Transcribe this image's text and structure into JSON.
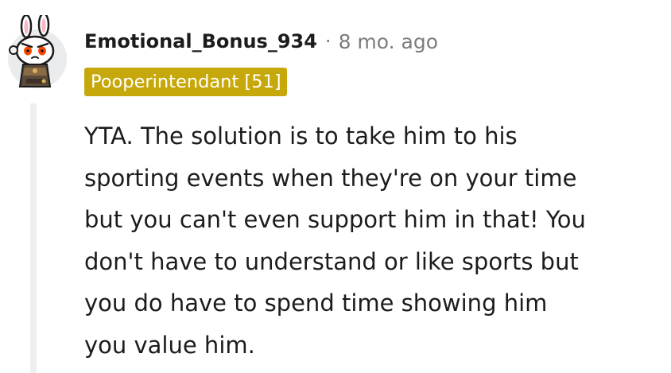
{
  "comment": {
    "author": "Emotional_Bonus_934",
    "separator": "·",
    "timestamp": "8 mo. ago",
    "flair": "Pooperintendant [51]",
    "lines": [
      "YTA. The solution is to take him to his",
      "sporting events when they're on your time",
      "but you can't even support him in that! You",
      "don't have to understand or like sports but",
      "you do have to spend time showing him",
      "you value him."
    ]
  },
  "colors": {
    "flair_background": "#c7a80a",
    "thread_line": "#edeff1",
    "meta_text": "#7c7c7c"
  },
  "icons": {
    "avatar": "snoo-avatar-bunny-ears"
  }
}
